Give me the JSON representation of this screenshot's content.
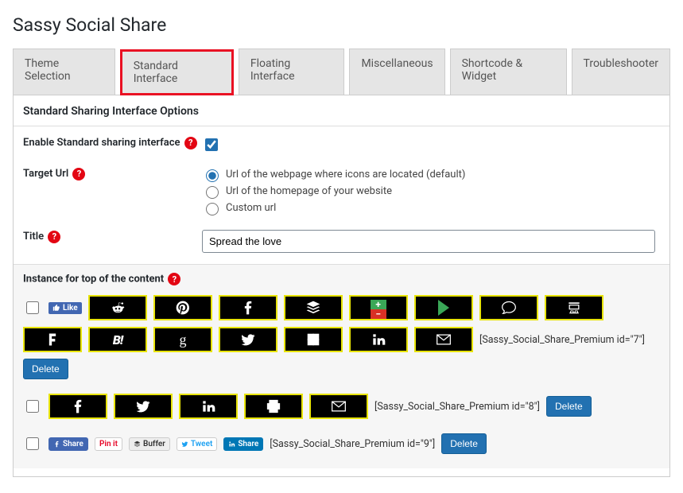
{
  "page_title": "Sassy Social Share",
  "tabs": {
    "theme": "Theme Selection",
    "standard": "Standard Interface",
    "floating": "Floating Interface",
    "misc": "Miscellaneous",
    "shortcode": "Shortcode & Widget",
    "trouble": "Troubleshooter"
  },
  "panel_heading": "Standard Sharing Interface Options",
  "labels": {
    "enable": "Enable Standard sharing interface",
    "target_url": "Target Url",
    "title": "Title",
    "instance_heading": "Instance for top of the content"
  },
  "radio_options": {
    "default": "Url of the webpage where icons are located (default)",
    "homepage": "Url of the homepage of your website",
    "custom": "Custom url"
  },
  "title_value": "Spread the love",
  "fb_like": "Like",
  "shortcodes": {
    "r1": "[Sassy_Social_Share_Premium id=\"7\"]",
    "r2": "[Sassy_Social_Share_Premium id=\"8\"]",
    "r3": "[Sassy_Social_Share_Premium id=\"9\"]"
  },
  "delete_label": "Delete",
  "badges": {
    "share": "Share",
    "pinit": "Pin it",
    "buffer": "Buffer",
    "tweet": "Tweet",
    "in_share": "Share"
  },
  "help_glyph": "?"
}
